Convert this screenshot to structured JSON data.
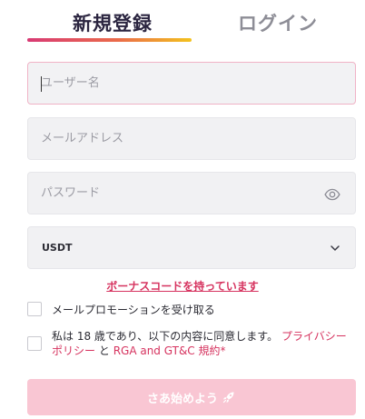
{
  "tabs": {
    "register": "新規登録",
    "login": "ログイン"
  },
  "form": {
    "username_placeholder": "ユーザー名",
    "email_placeholder": "メールアドレス",
    "password_placeholder": "パスワード",
    "currency_selected": "USDT"
  },
  "bonus_link": "ボーナスコードを持っています",
  "checkboxes": {
    "promo_label": "メールプロモーションを受け取る",
    "terms_prefix": "私は 18 歳であり、以下の内容に同意します。",
    "terms_privacy": "プライバシーポリシー",
    "terms_and": "と",
    "terms_rga": "RGA and GT&C 規約",
    "terms_star": "*"
  },
  "submit_label": "さあ始めよう",
  "colors": {
    "accent": "#d6335f",
    "submit_bg": "#f9c6d3",
    "tab_gradient_start": "#d83a74",
    "tab_gradient_end": "#f3c21e"
  },
  "icons": {
    "password": "eye-icon",
    "select": "chevron-down-icon",
    "submit": "rocket-icon"
  }
}
